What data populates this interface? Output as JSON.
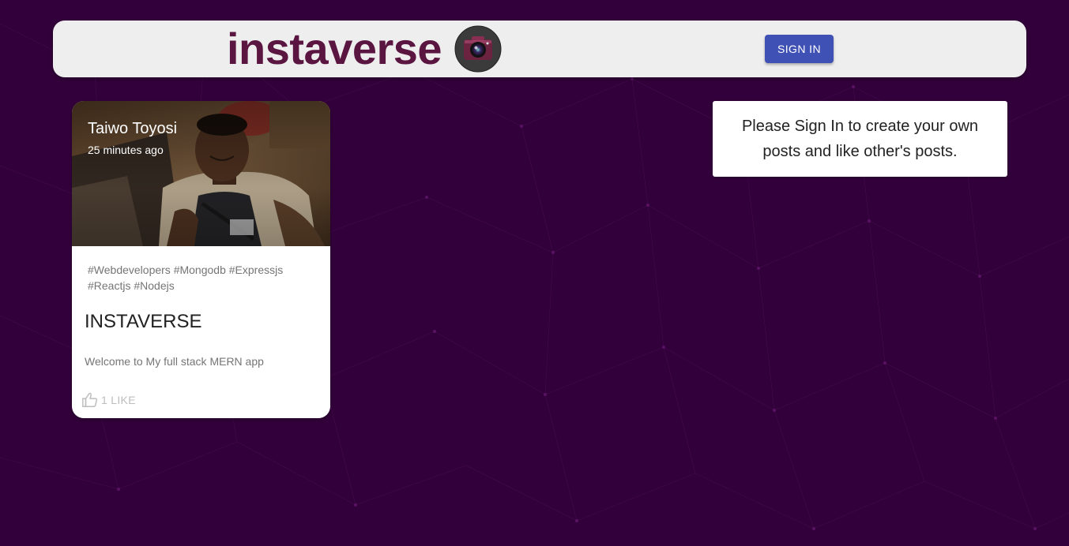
{
  "header": {
    "title": "instaverse",
    "logo_icon": "camera-icon",
    "sign_in_label": "SIGN IN"
  },
  "post": {
    "author": "Taiwo Toyosi",
    "time": "25 minutes ago",
    "tags": "#Webdevelopers #Mongodb #Expressjs #Reactjs #Nodejs",
    "title": "INSTAVERSE",
    "message": "Welcome to My full stack MERN app",
    "like_icon": "thumb-up-icon",
    "likes_label": "1 LIKE"
  },
  "notice": {
    "text": "Please Sign In to create your own posts and like other's posts."
  },
  "colors": {
    "background": "#32003a",
    "appbar": "#eeeeee",
    "brand_text": "#5a1640",
    "button": "#3f51b5",
    "card": "#ffffff"
  }
}
